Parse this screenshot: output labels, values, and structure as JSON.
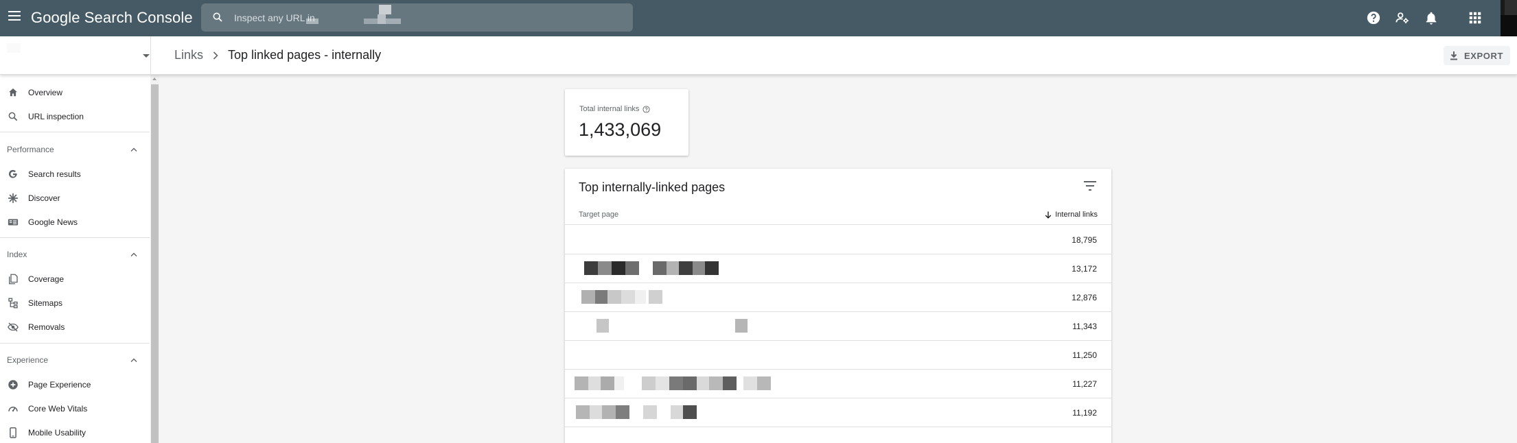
{
  "app": {
    "title": "Google Search Console",
    "search_placeholder": "Inspect any URL in"
  },
  "icons": {
    "menu": "menu-icon",
    "search": "search-icon",
    "help": "help-icon",
    "manage_users": "manage-users-icon",
    "notifications": "bell-icon",
    "apps": "apps-grid-icon",
    "account": "avatar"
  },
  "breadcrumb": {
    "parent": "Links",
    "current": "Top linked pages - internally"
  },
  "toolbar": {
    "export_label": "EXPORT"
  },
  "sidebar": {
    "top_items": [
      {
        "label": "Overview",
        "icon": "home-icon"
      },
      {
        "label": "URL inspection",
        "icon": "search-icon"
      }
    ],
    "sections": [
      {
        "label": "Performance",
        "items": [
          {
            "label": "Search results",
            "icon": "google-g-icon"
          },
          {
            "label": "Discover",
            "icon": "asterisk-icon"
          },
          {
            "label": "Google News",
            "icon": "news-icon"
          }
        ]
      },
      {
        "label": "Index",
        "items": [
          {
            "label": "Coverage",
            "icon": "copy-icon"
          },
          {
            "label": "Sitemaps",
            "icon": "sitemap-icon"
          },
          {
            "label": "Removals",
            "icon": "eye-off-icon"
          }
        ]
      },
      {
        "label": "Experience",
        "items": [
          {
            "label": "Page Experience",
            "icon": "plus-circle-icon"
          },
          {
            "label": "Core Web Vitals",
            "icon": "gauge-icon"
          },
          {
            "label": "Mobile Usability",
            "icon": "phone-icon"
          }
        ]
      }
    ]
  },
  "summary": {
    "label": "Total internal links",
    "value": "1,433,069"
  },
  "table": {
    "title": "Top internally-linked pages",
    "columns": [
      "Target page",
      "Internal links"
    ],
    "sort_column": "Internal links",
    "sort_direction": "descending",
    "rows": [
      {
        "links": "18,795"
      },
      {
        "links": "13,172"
      },
      {
        "links": "12,876"
      },
      {
        "links": "11,343"
      },
      {
        "links": "11,250"
      },
      {
        "links": "11,227"
      },
      {
        "links": "11,192"
      }
    ]
  },
  "colors": {
    "topbar": "#455a64",
    "background": "#f5f5f5",
    "card": "#ffffff",
    "text": "#202124",
    "muted": "#5f6368"
  }
}
